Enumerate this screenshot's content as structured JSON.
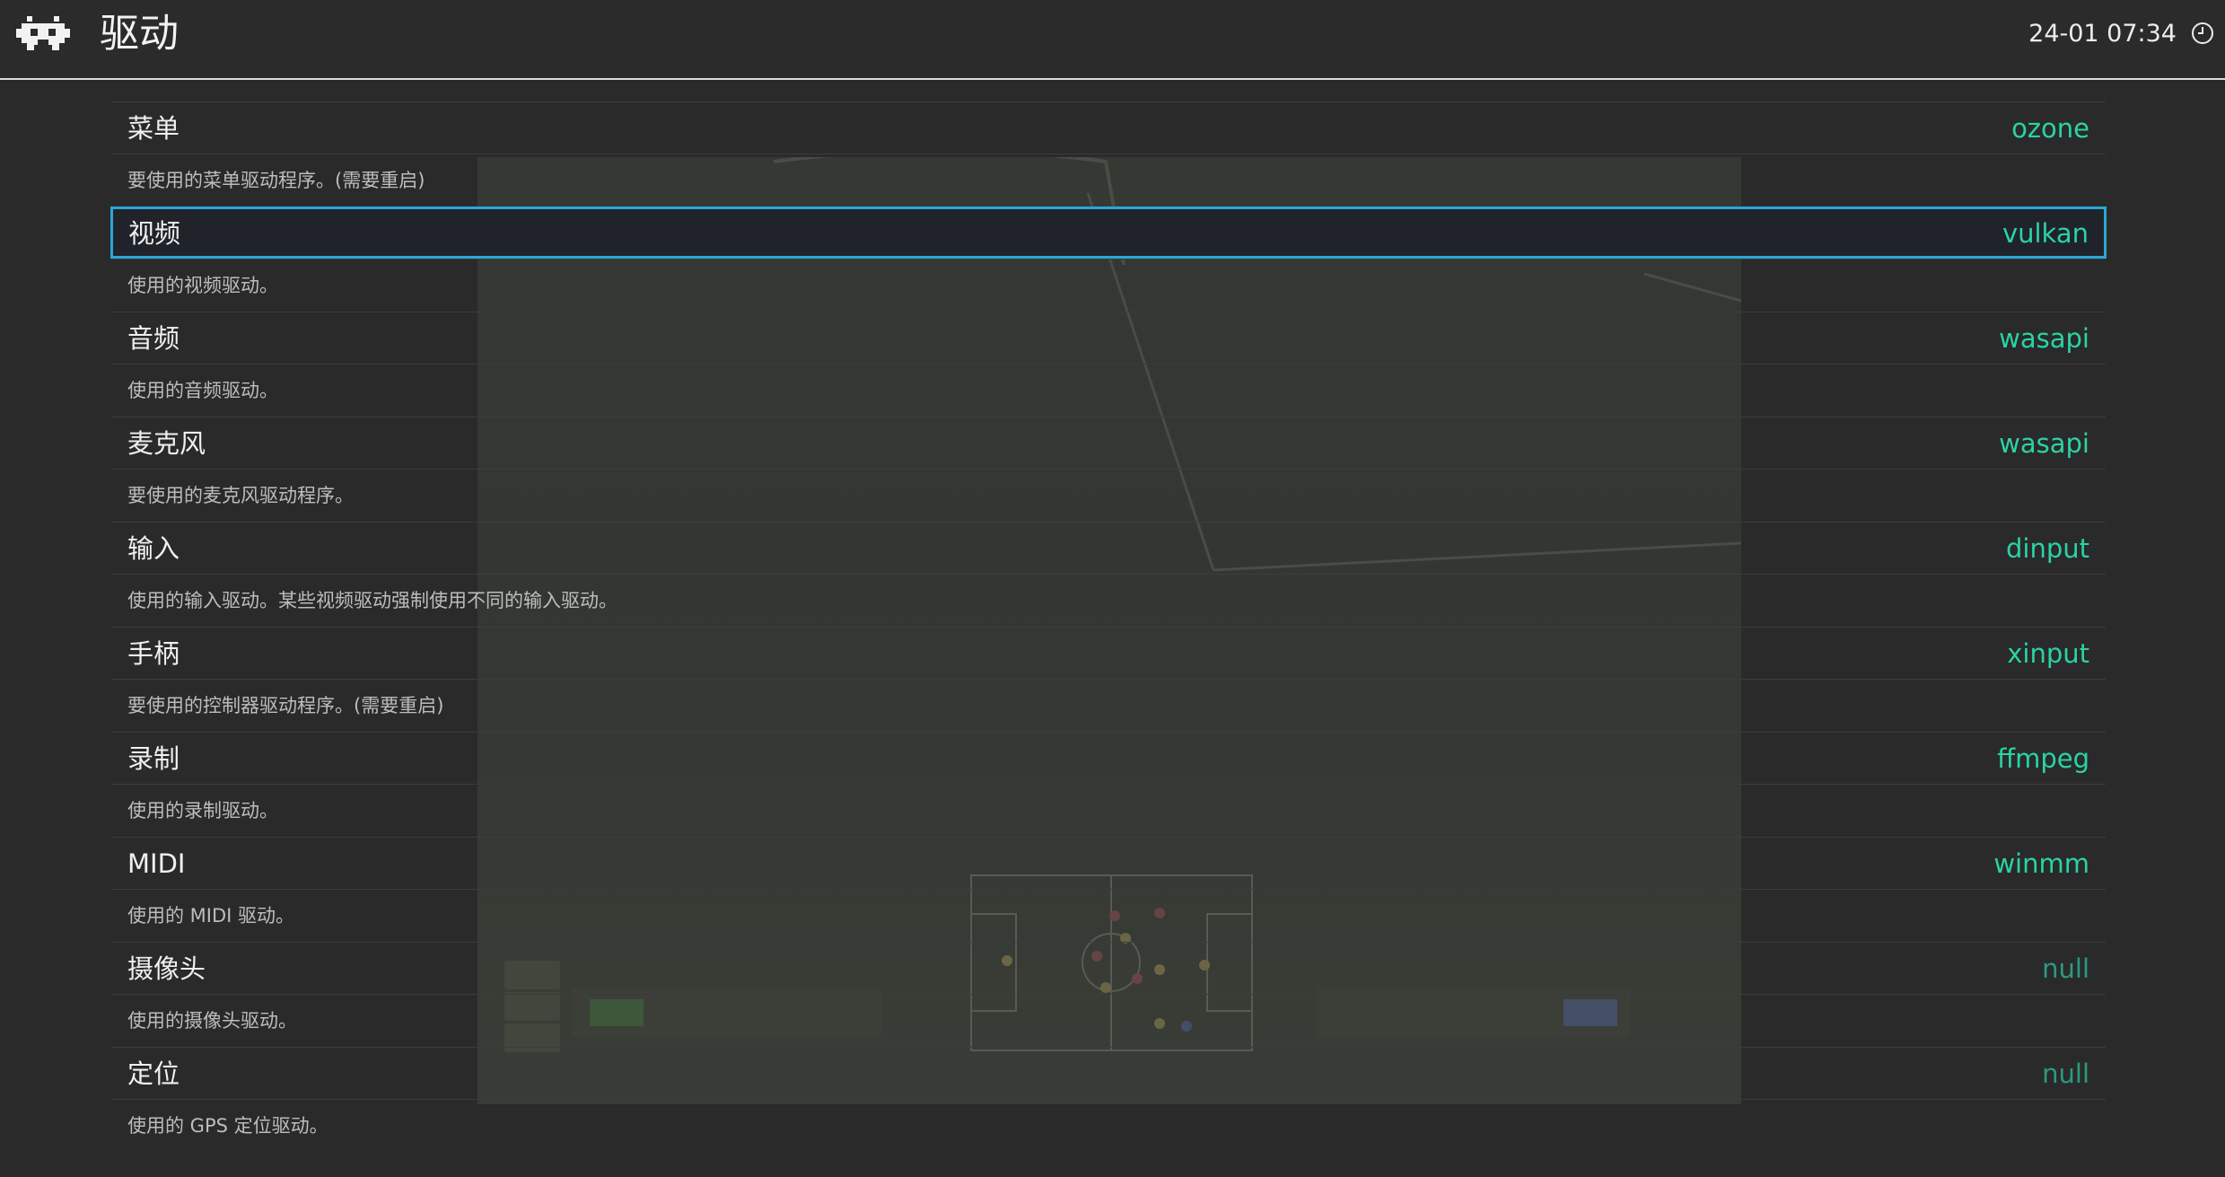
{
  "header": {
    "title": "驱动",
    "clock": "24-01 07:34",
    "logo_icon": "retroarch-invader-icon",
    "clock_icon": "clock-icon"
  },
  "colors": {
    "value": "#2ad3a3",
    "value_dim": "#2a9a80",
    "selection_border": "#2aa7d6"
  },
  "items": [
    {
      "label": "菜单",
      "value": "ozone",
      "description": "要使用的菜单驱动程序。(需要重启)"
    },
    {
      "label": "视频",
      "value": "vulkan",
      "description": "使用的视频驱动。",
      "selected": true
    },
    {
      "label": "音频",
      "value": "wasapi",
      "description": "使用的音频驱动。"
    },
    {
      "label": "麦克风",
      "value": "wasapi",
      "description": "要使用的麦克风驱动程序。"
    },
    {
      "label": "输入",
      "value": "dinput",
      "description": "使用的输入驱动。某些视频驱动强制使用不同的输入驱动。"
    },
    {
      "label": "手柄",
      "value": "xinput",
      "description": "要使用的控制器驱动程序。(需要重启)"
    },
    {
      "label": "录制",
      "value": "ffmpeg",
      "description": "使用的录制驱动。"
    },
    {
      "label": "MIDI",
      "value": "winmm",
      "description": "使用的 MIDI 驱动。"
    },
    {
      "label": "摄像头",
      "value": "null",
      "description": "使用的摄像头驱动。"
    },
    {
      "label": "定位",
      "value": "null",
      "description": "使用的 GPS 定位驱动。"
    }
  ]
}
